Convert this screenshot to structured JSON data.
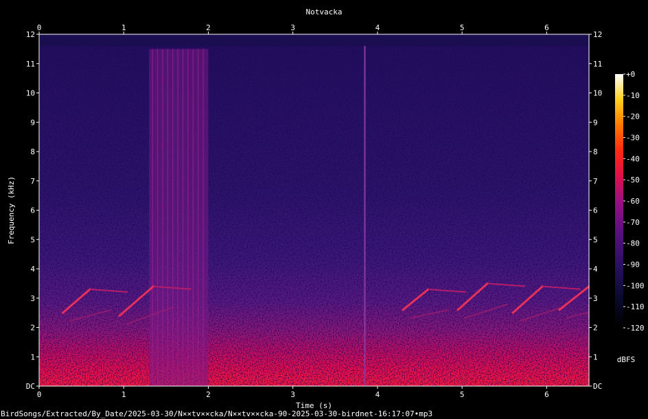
{
  "chart_data": {
    "type": "heatmap",
    "title": "Notvacka",
    "xlabel": "Time (s)",
    "ylabel": "Frequency (kHz)",
    "xlim": [
      0,
      6.5
    ],
    "ylim": [
      0,
      12
    ],
    "x_ticks": [
      "0",
      "1",
      "2",
      "3",
      "4",
      "5",
      "6"
    ],
    "y_ticks": [
      "DC",
      "1",
      "2",
      "3",
      "4",
      "5",
      "6",
      "7",
      "8",
      "9",
      "10",
      "11",
      "12"
    ],
    "colorbar": {
      "label": "dBFS",
      "ticks": [
        "+0",
        "-10",
        "-20",
        "-30",
        "-40",
        "-50",
        "-60",
        "-70",
        "-80",
        "-90",
        "-100",
        "-110",
        "-120"
      ],
      "range": [
        -120,
        0
      ]
    },
    "features": [
      {
        "name": "broadband burst",
        "t_start": 1.3,
        "t_end": 2.0,
        "f_low": 0.0,
        "f_high": 11.5
      },
      {
        "name": "click",
        "t": 3.85,
        "f_low": 0.0,
        "f_high": 11.6
      },
      {
        "name": "chirp",
        "t_start": 0.28,
        "t_end": 0.6,
        "f_start": 2.5,
        "f_end": 3.3
      },
      {
        "name": "chirp",
        "t_start": 0.95,
        "t_end": 1.35,
        "f_start": 2.4,
        "f_end": 3.4
      },
      {
        "name": "chirp",
        "t_start": 4.3,
        "t_end": 4.6,
        "f_start": 2.6,
        "f_end": 3.3
      },
      {
        "name": "chirp",
        "t_start": 4.95,
        "t_end": 5.3,
        "f_start": 2.6,
        "f_end": 3.5
      },
      {
        "name": "chirp",
        "t_start": 5.6,
        "t_end": 5.95,
        "f_start": 2.5,
        "f_end": 3.4
      },
      {
        "name": "chirp",
        "t_start": 6.15,
        "t_end": 6.5,
        "f_start": 2.6,
        "f_end": 3.4
      }
    ]
  },
  "footer": {
    "file_path": "BirdSongs/Extracted/By_Date/2025-03-30/N××tv××cka/N××tv××cka-90-2025-03-30-birdnet-16:17:07•mp3"
  }
}
